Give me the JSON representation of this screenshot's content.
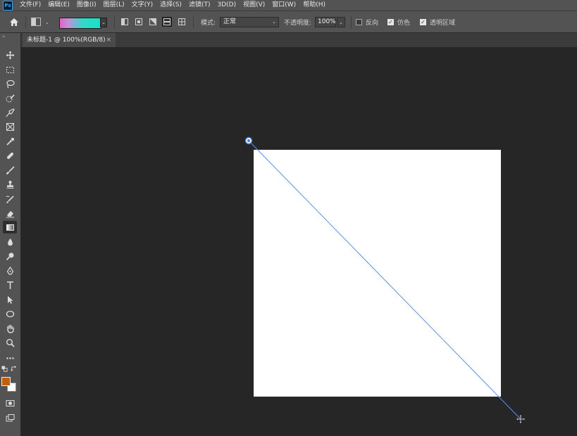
{
  "app": {
    "logo": "Ps",
    "accent": "#31a8ff"
  },
  "menubar": {
    "items": [
      "文件(F)",
      "编辑(E)",
      "图像(I)",
      "图层(L)",
      "文字(Y)",
      "选择(S)",
      "滤镜(T)",
      "3D(D)",
      "视图(V)",
      "窗口(W)",
      "帮助(H)"
    ]
  },
  "options": {
    "home_icon": "home-icon",
    "gradient_colors": [
      "#e062c6",
      "#18e1c6"
    ],
    "mode_label": "模式:",
    "mode_value": "正常",
    "opacity_label": "不透明度:",
    "opacity_value": "100%",
    "reverse_label": "反向",
    "reverse_checked": false,
    "dither_label": "仿色",
    "dither_checked": true,
    "transparency_label": "透明区域",
    "transparency_checked": true,
    "chevron": "⌄"
  },
  "tab": {
    "title": "未标题-1 @ 100%(RGB/8)",
    "close": "×"
  },
  "toolbar": {
    "collapse": "»",
    "fg_color": "#c15f0a",
    "bg_color": "#ffffff"
  },
  "document": {
    "background": "#ffffff",
    "gradient_line_color": "#5b8fe6"
  }
}
